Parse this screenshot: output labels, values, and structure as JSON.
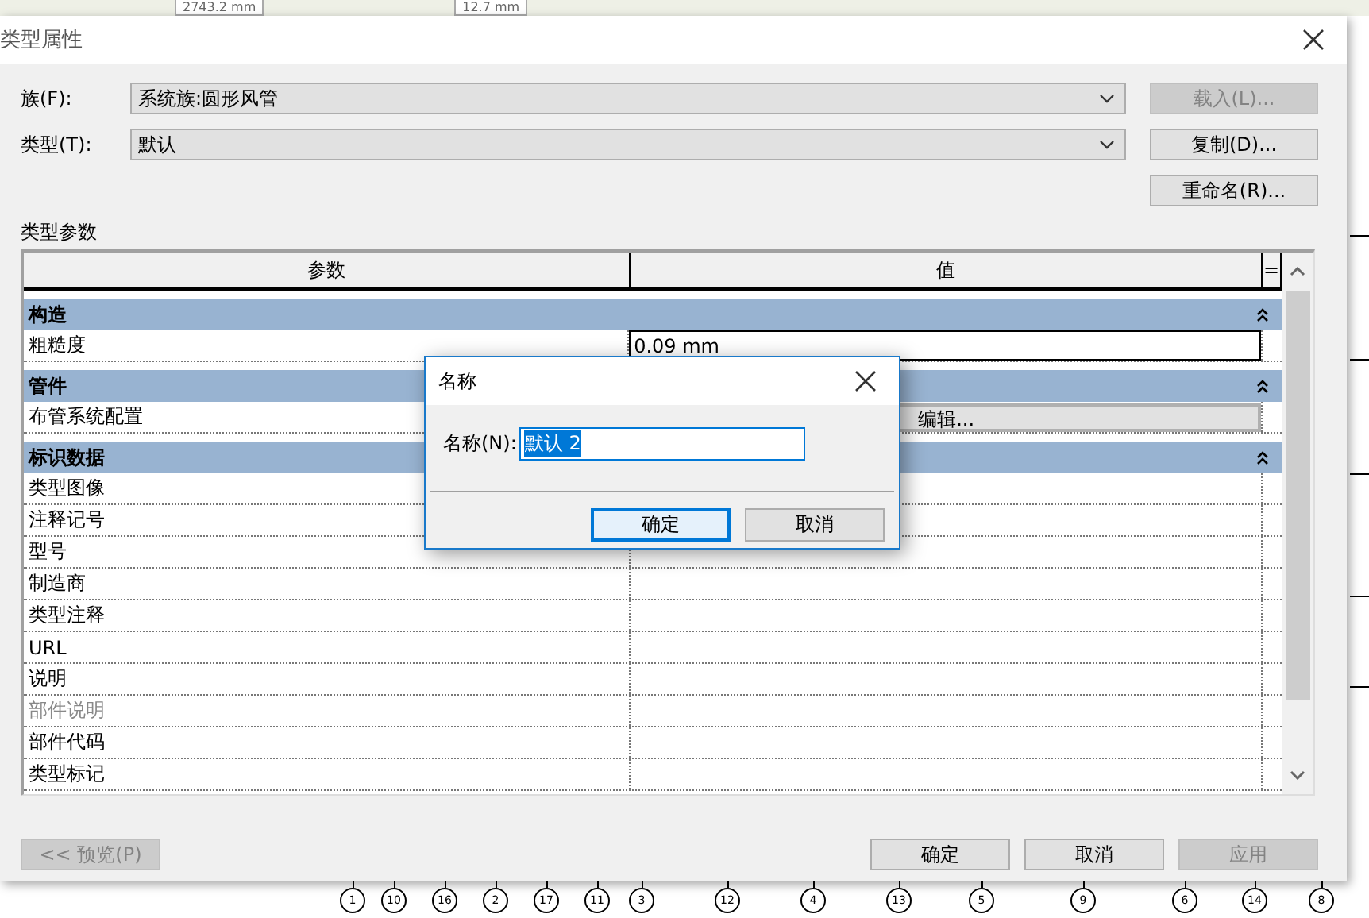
{
  "toolbar": {
    "items": [
      "2743.2 mm",
      "12.7 mm"
    ]
  },
  "window": {
    "title": "类型属性"
  },
  "fields": [
    {
      "label": "族(F):",
      "value": "系统族:圆形风管",
      "button": "载入(L)...",
      "button_disabled": true
    },
    {
      "label": "类型(T):",
      "value": "默认",
      "button": "复制(D)...",
      "button_disabled": false
    }
  ],
  "rename_button": "重命名(R)...",
  "section_label": "类型参数",
  "table": {
    "columns": [
      "参数",
      "值",
      "="
    ],
    "rows": [
      {
        "kind": "group",
        "name": "构造",
        "expanded": true
      },
      {
        "kind": "param",
        "name": "粗糙度",
        "value": {
          "kind": "input",
          "text": "0.09 mm"
        },
        "disabled": false
      },
      {
        "kind": "group",
        "name": "管件",
        "expanded": true
      },
      {
        "kind": "param",
        "name": "布管系统配置",
        "value": {
          "kind": "button",
          "text": "编辑..."
        },
        "disabled": false
      },
      {
        "kind": "group",
        "name": "标识数据",
        "expanded": true
      },
      {
        "kind": "param",
        "name": "类型图像",
        "disabled": false
      },
      {
        "kind": "param",
        "name": "注释记号",
        "disabled": false
      },
      {
        "kind": "param",
        "name": "型号",
        "disabled": false
      },
      {
        "kind": "param",
        "name": "制造商",
        "disabled": false
      },
      {
        "kind": "param",
        "name": "类型注释",
        "disabled": false
      },
      {
        "kind": "param",
        "name": "URL",
        "disabled": false
      },
      {
        "kind": "param",
        "name": "说明",
        "disabled": false
      },
      {
        "kind": "param",
        "name": "部件说明",
        "disabled": true
      },
      {
        "kind": "param",
        "name": "部件代码",
        "disabled": false
      },
      {
        "kind": "param",
        "name": "类型标记",
        "disabled": false
      }
    ]
  },
  "footer": {
    "preview": {
      "label": "<< 预览(P)",
      "disabled": true
    },
    "buttons": [
      {
        "label": "确定",
        "disabled": false
      },
      {
        "label": "取消",
        "disabled": false
      },
      {
        "label": "应用",
        "disabled": true
      }
    ]
  },
  "name_dialog": {
    "title": "名称",
    "label": "名称(N):",
    "value": "默认 2",
    "buttons": [
      {
        "label": "确定",
        "default": true
      },
      {
        "label": "取消",
        "default": false
      }
    ]
  },
  "grid_bubbles": [
    "1",
    "10",
    "16",
    "2",
    "17",
    "11",
    "3",
    "12",
    "4",
    "13",
    "5",
    "9",
    "6",
    "14",
    "8"
  ]
}
